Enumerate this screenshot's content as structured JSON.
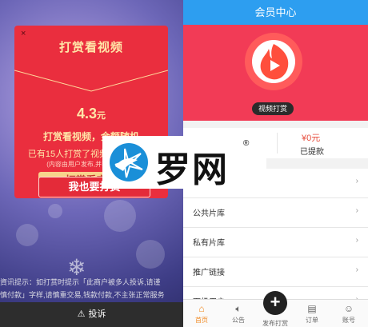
{
  "popup": {
    "close": "×",
    "title": "打赏看视频",
    "amount": "4.3",
    "amount_unit": "元",
    "desc": "打赏看视频，金额随机",
    "count": "已有15人打赏了视频打赏 的视频",
    "note": "(内容由用户发布,并非平台提供)",
    "reward_button": "打赏看完整",
    "also_button": "我也要打赏"
  },
  "ticker_line1": "資讯提示：如打赏时提示「此商户被多人投诉,请谨",
  "ticker_line2": "慎付款」字样,请慎重交易,钱款付款,不主张正常服务",
  "complain": {
    "icon": "warning-icon",
    "label": "投诉"
  },
  "header": {
    "title": "会员中心"
  },
  "badge": "视频打赏",
  "stats": {
    "money": "¥0元",
    "withdrawn": "已提款"
  },
  "menu": [
    {
      "label": ""
    },
    {
      "label": "公共片库"
    },
    {
      "label": "私有片库"
    },
    {
      "label": "推广链接"
    },
    {
      "label": "下级用户"
    }
  ],
  "tabs": [
    {
      "label": "首页",
      "icon": "home-icon"
    },
    {
      "label": "公告",
      "icon": "speaker-icon"
    },
    {
      "label": "发布打赏",
      "icon": "plus-icon"
    },
    {
      "label": "订单",
      "icon": "order-icon"
    },
    {
      "label": "账号",
      "icon": "user-icon"
    }
  ],
  "watermark": {
    "text": "罗网",
    "reg": "®"
  },
  "colors": {
    "brand_red": "#f23b56",
    "header_blue": "#2d9ef0",
    "popup_red": "#ea2e3e",
    "gold": "#f7d48c"
  }
}
